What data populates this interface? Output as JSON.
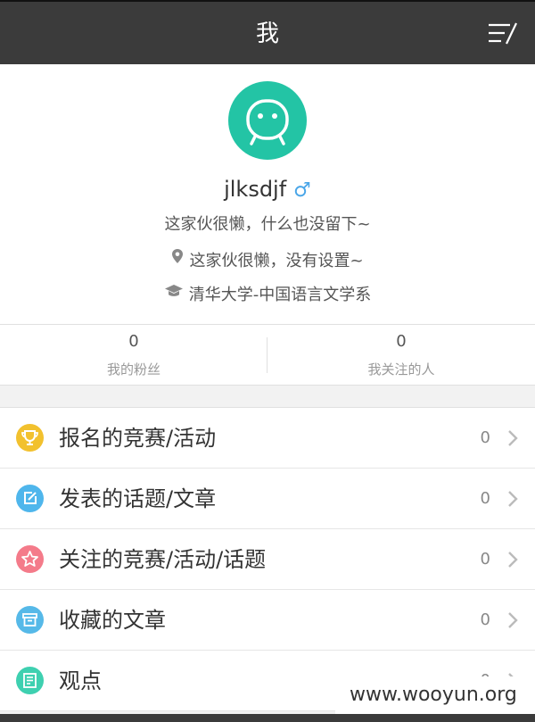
{
  "header": {
    "title": "我",
    "menu_icon": "menu-edit-icon"
  },
  "profile": {
    "avatar_icon": "robot-avatar-icon",
    "avatar_color": "#23c4a5",
    "username": "jlksdjf",
    "gender_symbol": "♂",
    "bio": "这家伙很懒，什么也没留下~",
    "location": "这家伙很懒，没有设置~",
    "school": "清华大学-中国语言文学系"
  },
  "stats": {
    "followers_count": "0",
    "followers_label": "我的粉丝",
    "following_count": "0",
    "following_label": "我关注的人"
  },
  "menu": {
    "items": [
      {
        "label": "报名的竞赛/活动",
        "count": "0",
        "icon": "trophy-icon",
        "color": "#f2c12e"
      },
      {
        "label": "发表的话题/文章",
        "count": "0",
        "icon": "edit-icon",
        "color": "#4fb6ec"
      },
      {
        "label": "关注的竞赛/活动/话题",
        "count": "0",
        "icon": "star-icon",
        "color": "#f47b8a"
      },
      {
        "label": "收藏的文章",
        "count": "0",
        "icon": "archive-icon",
        "color": "#56b9e8"
      },
      {
        "label": "观点",
        "count": "0",
        "icon": "note-icon",
        "color": "#3ed0b0"
      }
    ]
  },
  "watermark": "www.wooyun.org"
}
